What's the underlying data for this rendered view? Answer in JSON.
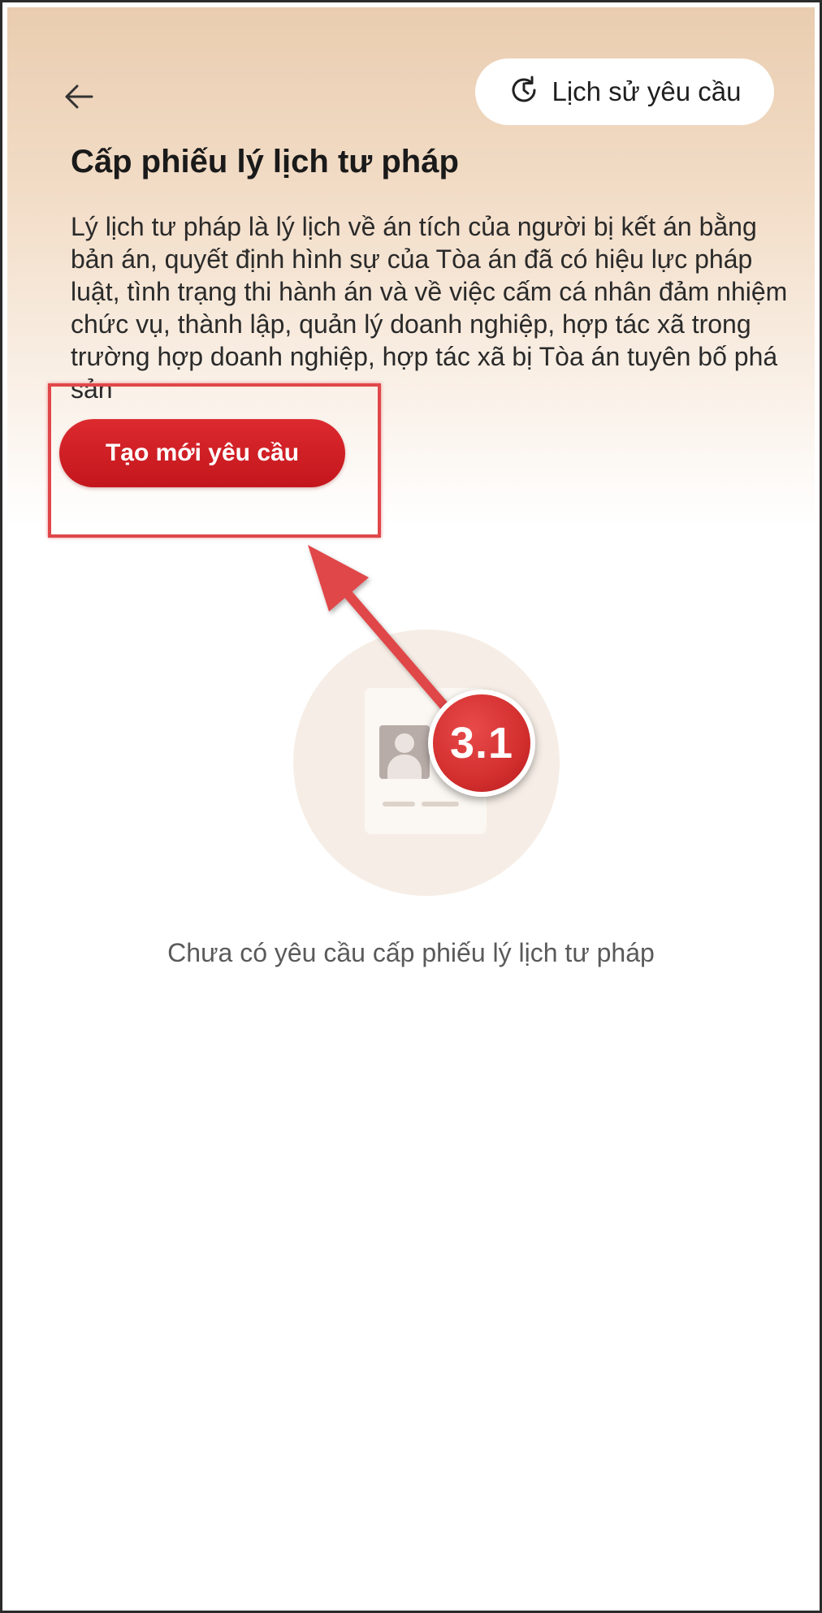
{
  "header": {
    "back_icon": "arrow-left-icon",
    "history_button_label": "Lịch sử yêu cầu",
    "history_icon": "clock-history-icon"
  },
  "page": {
    "title": "Cấp phiếu lý lịch tư pháp",
    "description": "Lý lịch tư pháp là lý lịch về án tích của người bị kết án bằng bản án, quyết định hình sự của Tòa án đã có hiệu lực pháp luật, tình trạng thi hành án và về việc cấm cá nhân đảm nhiệm chức vụ, thành lập, quản lý doanh nghiệp, hợp tác xã trong trường hợp doanh nghiệp, hợp tác xã bị Tòa án tuyên bố phá sản"
  },
  "actions": {
    "create_button_label": "Tạo mới yêu cầu"
  },
  "annotation": {
    "step_label": "3.1",
    "color": "#e0474a"
  },
  "empty_state": {
    "icon": "document-avatar-icon",
    "message": "Chưa có yêu cầu cấp phiếu lý lịch tư pháp"
  },
  "colors": {
    "primary_red": "#c8181e",
    "header_gradient_top": "#e9cdb0"
  }
}
